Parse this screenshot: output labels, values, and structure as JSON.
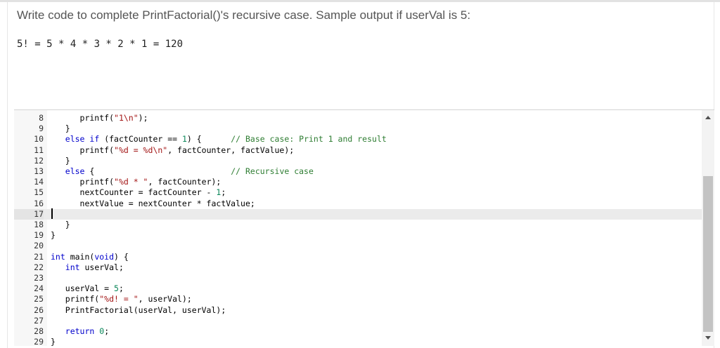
{
  "question": {
    "prompt": "Write code to complete PrintFactorial()'s recursive case. Sample output if userVal is 5:",
    "sample_output": "5! = 5 * 4 * 3 * 2 * 1 = 120"
  },
  "editor": {
    "cursor_line": "17",
    "lines": [
      {
        "n": "8",
        "code": "      printf(\"1\\n\");"
      },
      {
        "n": "9",
        "code": "   }"
      },
      {
        "n": "10",
        "code": "   else if (factCounter == 1) {      // Base case: Print 1 and result"
      },
      {
        "n": "11",
        "code": "      printf(\"%d = %d\\n\", factCounter, factValue);"
      },
      {
        "n": "12",
        "code": "   }"
      },
      {
        "n": "13",
        "code": "   else {                            // Recursive case"
      },
      {
        "n": "14",
        "code": "      printf(\"%d * \", factCounter);"
      },
      {
        "n": "15",
        "code": "      nextCounter = factCounter - 1;"
      },
      {
        "n": "16",
        "code": "      nextValue = nextCounter * factValue;"
      },
      {
        "n": "17",
        "code": ""
      },
      {
        "n": "18",
        "code": "   }"
      },
      {
        "n": "19",
        "code": "}"
      },
      {
        "n": "20",
        "code": ""
      },
      {
        "n": "21",
        "code": "int main(void) {"
      },
      {
        "n": "22",
        "code": "   int userVal;"
      },
      {
        "n": "23",
        "code": ""
      },
      {
        "n": "24",
        "code": "   userVal = 5;"
      },
      {
        "n": "25",
        "code": "   printf(\"%d! = \", userVal);"
      },
      {
        "n": "26",
        "code": "   PrintFactorial(userVal, userVal);"
      },
      {
        "n": "27",
        "code": ""
      },
      {
        "n": "28",
        "code": "   return 0;"
      },
      {
        "n": "29",
        "code": "}"
      }
    ]
  }
}
